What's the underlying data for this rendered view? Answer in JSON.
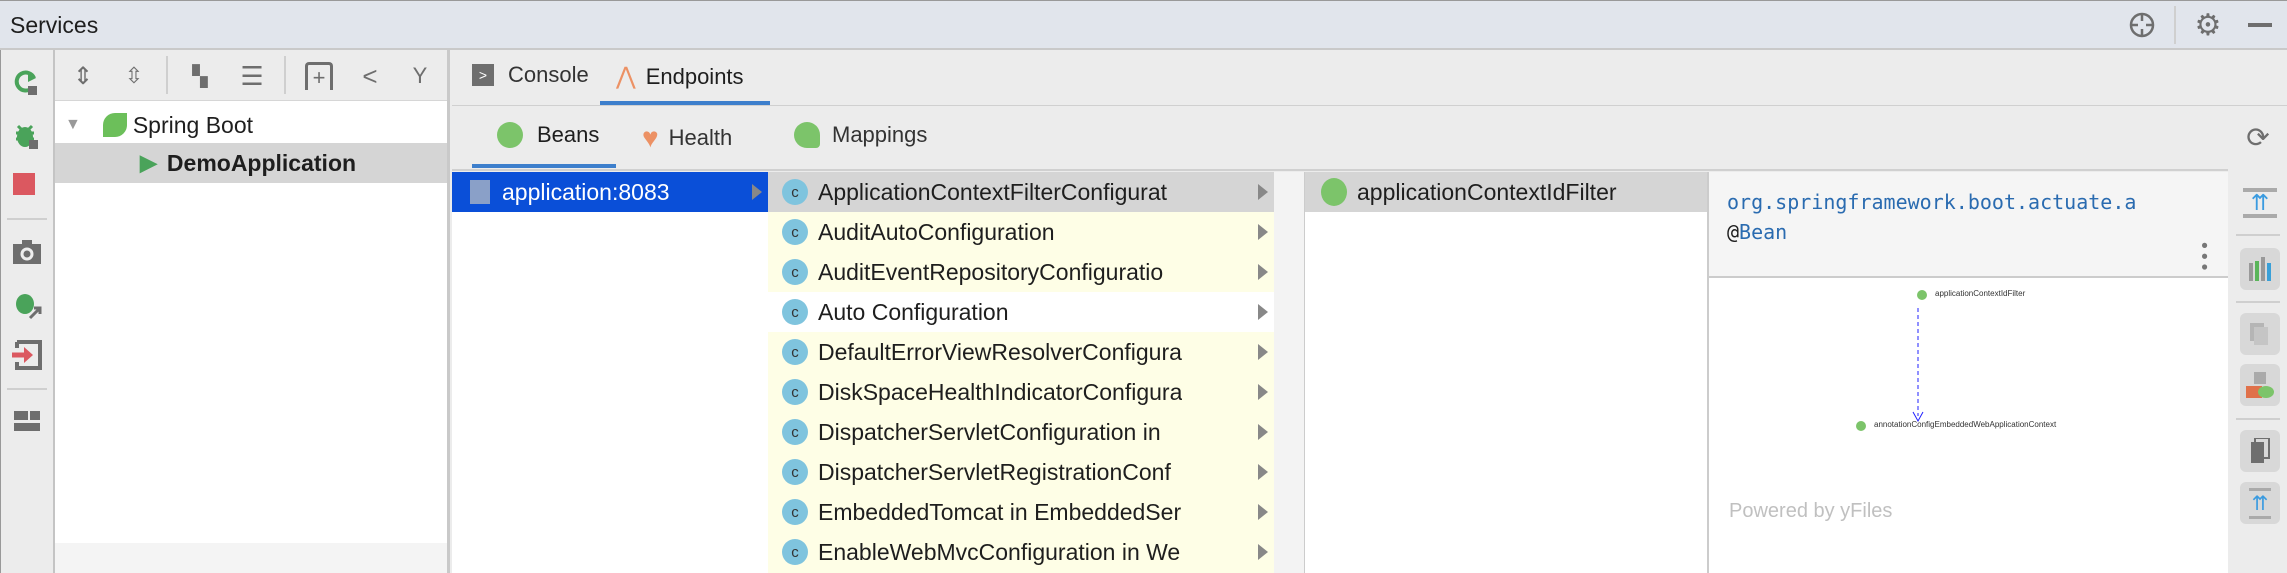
{
  "header": {
    "title": "Services"
  },
  "left_toolbar": [
    "refresh-icon",
    "debug-icon",
    "stop-icon",
    "camera-icon",
    "attach-debugger-icon",
    "login-icon",
    "layout-icon"
  ],
  "tree": {
    "toolbar": [
      "expand-all-icon",
      "collapse-all-icon",
      "group-icon",
      "list-icon",
      "add-service-icon",
      "tree-icon",
      "filter-icon"
    ],
    "root": "Spring Boot",
    "child": "DemoApplication"
  },
  "tabs": {
    "console": "Console",
    "endpoints": "Endpoints"
  },
  "subtabs": {
    "beans": "Beans",
    "health": "Health",
    "mappings": "Mappings"
  },
  "col1": {
    "items": [
      "application:8083"
    ]
  },
  "col2": {
    "items": [
      "ApplicationContextFilterConfigurat",
      "AuditAutoConfiguration",
      "AuditEventRepositoryConfiguratio",
      "Auto Configuration",
      "DefaultErrorViewResolverConfigura",
      "DiskSpaceHealthIndicatorConfigura",
      "DispatcherServletConfiguration in",
      "DispatcherServletRegistrationConf",
      "EmbeddedTomcat in EmbeddedSer",
      "EnableWebMvcConfiguration in We"
    ]
  },
  "col3": {
    "items": [
      "applicationContextIdFilter"
    ]
  },
  "detail": {
    "package": "org.springframework.boot.actuate.a",
    "at": "@",
    "annotation": "Bean",
    "diagram_nodes": [
      "applicationContextIdFilter",
      "annotationConfigEmbeddedWebApplicationContext"
    ],
    "watermark": "Powered by yFiles"
  },
  "colors": {
    "selection": "#0a4fd8",
    "accent": "#3d7fcc",
    "yellow": "#fefee6"
  }
}
